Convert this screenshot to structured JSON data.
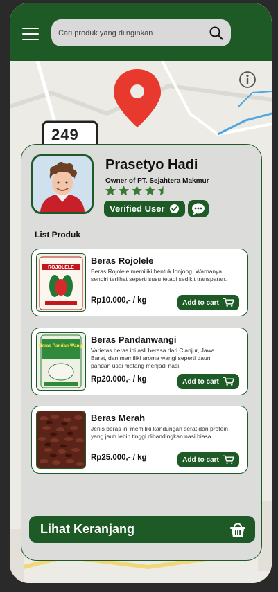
{
  "header": {
    "search_placeholder": "Cari produk yang diinginkan",
    "icons": [
      "menu-icon",
      "search-icon"
    ]
  },
  "map": {
    "road_number": "249",
    "icons": [
      "location-pin-icon",
      "info-icon"
    ]
  },
  "seller": {
    "name": "Prasetyo Hadi",
    "subtitle": "Owner of PT. Sejahtera Makmur",
    "rating": 4.5,
    "verified_label": "Verified User"
  },
  "products_section": {
    "title": "List Produk",
    "items": [
      {
        "name": "Beras Rojolele",
        "description": "Beras Rojolele memiliki bentuk lonjong. Warnanya sendiri terlihat seperti susu tetapi sedikit transparan.",
        "price": "Rp10.000,- / kg",
        "button": "Add to cart",
        "bag_text": "ROJOLELE"
      },
      {
        "name": "Beras Pandanwangi",
        "description": "Varietas beras ini asli berasa dari Cianjur, Jawa Barat, dan memiliki aroma wangi seperti daun pandan usai matang menjadi nasi.",
        "price": "Rp20.000,- / kg",
        "button": "Add to cart",
        "bag_text": "Beras Pandan Wangi"
      },
      {
        "name": "Beras Merah",
        "description": "Jenis beras ini memiliki kandungan serat dan protein yang jauh lebih tinggi dibandingkan nasi biasa.",
        "price": "Rp25.000,- / kg",
        "button": "Add to cart"
      }
    ]
  },
  "cart": {
    "label": "Lihat Keranjang"
  },
  "colors": {
    "primary": "#1d5a26",
    "pin": "#e8392f",
    "star": "#3b7a33",
    "card_bg": "#dcdcdb"
  }
}
